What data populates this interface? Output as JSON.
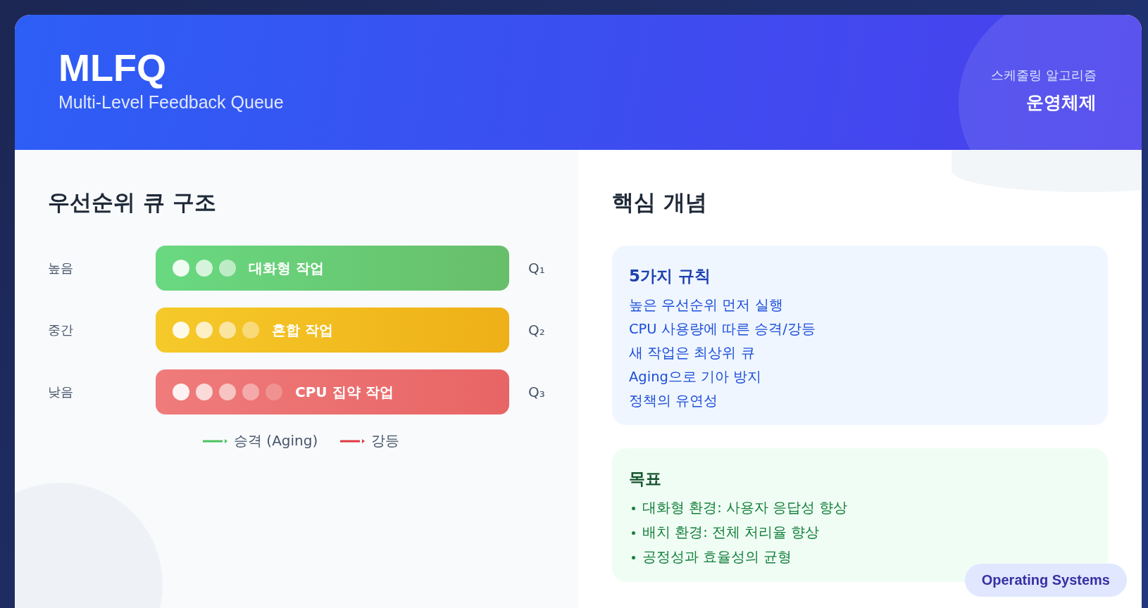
{
  "header": {
    "title": "MLFQ",
    "subtitle": "Multi-Level Feedback Queue",
    "category": "스케줄링 알고리즘",
    "subject": "운영체제"
  },
  "structure": {
    "title": "우선순위 큐 구조",
    "queues": [
      {
        "priority": "높음",
        "label": "대화형 작업",
        "queue": "Q₁",
        "color": "#5cd676"
      },
      {
        "priority": "중간",
        "label": "혼합 작업",
        "queue": "Q₂",
        "color": "#f5c518"
      },
      {
        "priority": "낮음",
        "label": "CPU 집약 작업",
        "queue": "Q₃",
        "color": "#ee7070"
      }
    ],
    "legend": [
      {
        "label": "승격 (Aging)",
        "color": "#4cc15f"
      },
      {
        "label": "강등",
        "color": "#e0393e"
      }
    ]
  },
  "concepts": {
    "title": "핵심 개념",
    "rules": {
      "title": "5가지 규칙",
      "items": [
        "높은 우선순위 먼저 실행",
        "CPU 사용량에 따른 승격/강등",
        "새 작업은 최상위 큐",
        "Aging으로 기아 방지",
        "정책의 유연성"
      ]
    },
    "goals": {
      "title": "목표",
      "items": [
        "대화형 환경: 사용자 응답성 향상",
        "배치 환경: 전체 처리율 향상",
        "공정성과 효율성의 균형"
      ]
    }
  },
  "badge": "Operating Systems"
}
